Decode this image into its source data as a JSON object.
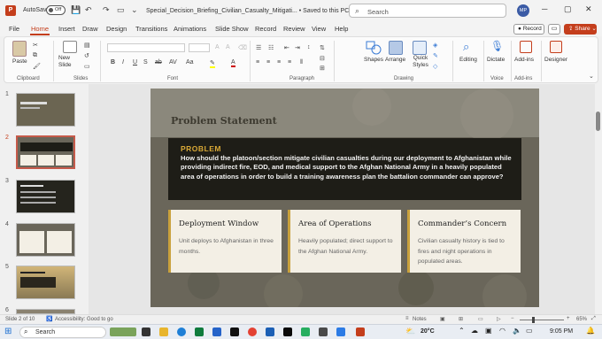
{
  "titlebar": {
    "autosave_label": "AutoSave",
    "autosave_state": "Off",
    "filename": "Special_Decision_Briefing_Civilian_Casualty_Mitigati... • Saved to this PC ⌄",
    "search_placeholder": "Search",
    "user_initials": "MP"
  },
  "menu": {
    "tabs": [
      "File",
      "Home",
      "Insert",
      "Draw",
      "Design",
      "Transitions",
      "Animations",
      "Slide Show",
      "Record",
      "Review",
      "View",
      "Help"
    ],
    "active": "Home",
    "record_label": "Record",
    "share_label": "Share"
  },
  "ribbon": {
    "paste": "Paste",
    "new_slide": "New Slide",
    "shapes": "Shapes",
    "arrange": "Arrange",
    "quick_styles": "Quick Styles",
    "editing": "Editing",
    "dictate": "Dictate",
    "addins": "Add-ins",
    "designer": "Designer",
    "groups": {
      "clipboard": "Clipboard",
      "slides": "Slides",
      "font": "Font",
      "paragraph": "Paragraph",
      "drawing": "Drawing",
      "voice": "Voice",
      "addins": "Add-ins"
    }
  },
  "thumbnails": {
    "numbers": [
      "1",
      "2",
      "3",
      "4",
      "5",
      "6"
    ],
    "selected": "2"
  },
  "slide": {
    "title": "Problem Statement",
    "problem_label": "PROBLEM",
    "problem_text": "How should the platoon/section mitigate civilian casualties during our deployment to Afghanistan while providing indirect fire, EOD, and medical support to the Afghan National Army in a heavily populated area of operations  in order to build a training awareness plan the battalion commander can approve?",
    "cards": [
      {
        "title": "Deployment Window",
        "body": "Unit deploys to Afghanistan in three months."
      },
      {
        "title": "Area of Operations",
        "body": "Heavily populated; direct support to the Afghan National Army."
      },
      {
        "title": "Commander’s Concern",
        "body": "Civilian casualty history is tied to fires and night operations in populated areas."
      }
    ]
  },
  "statusbar": {
    "slide_info": "Slide 2 of 10",
    "accessibility": "Accessibility: Good to go",
    "notes": "Notes",
    "zoom": "65%"
  },
  "taskbar": {
    "search": "Search",
    "temperature": "20°C",
    "time": "9:05 PM"
  },
  "colors": {
    "accent": "#c43e1c",
    "gold": "#d8a836",
    "problem_bg": "#1e1d17"
  }
}
